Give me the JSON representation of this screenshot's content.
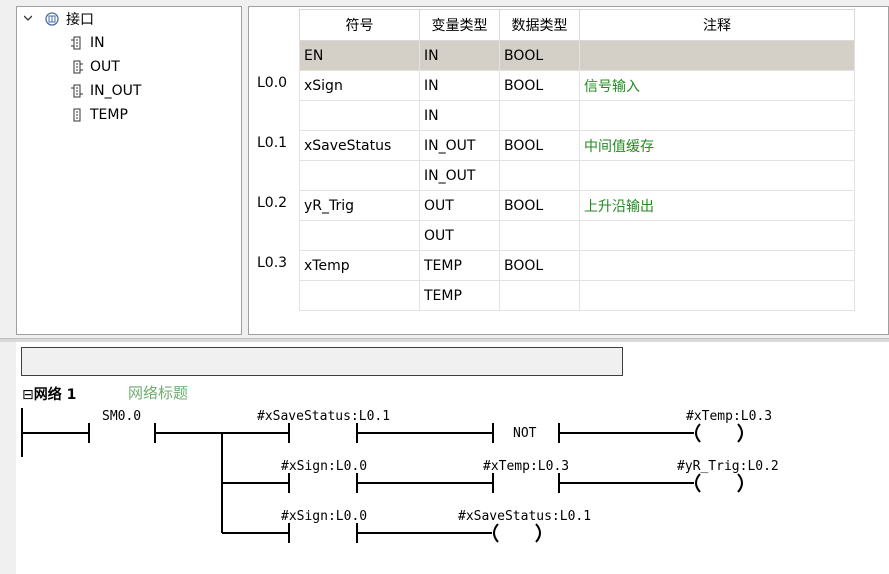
{
  "tree": {
    "root_label": "接口",
    "items": [
      {
        "label": "IN"
      },
      {
        "label": "OUT"
      },
      {
        "label": "IN_OUT"
      },
      {
        "label": "TEMP"
      }
    ]
  },
  "table": {
    "headers": [
      "符号",
      "变量类型",
      "数据类型",
      "注释"
    ],
    "rows": [
      {
        "addr": "",
        "symbol": "EN",
        "vartype": "IN",
        "datatype": "BOOL",
        "comment": ""
      },
      {
        "addr": "L0.0",
        "symbol": "xSign",
        "vartype": "IN",
        "datatype": "BOOL",
        "comment": "信号输入"
      },
      {
        "addr": "",
        "symbol": "",
        "vartype": "IN",
        "datatype": "",
        "comment": ""
      },
      {
        "addr": "L0.1",
        "symbol": "xSaveStatus",
        "vartype": "IN_OUT",
        "datatype": "BOOL",
        "comment": "中间值缓存"
      },
      {
        "addr": "",
        "symbol": "",
        "vartype": "IN_OUT",
        "datatype": "",
        "comment": ""
      },
      {
        "addr": "L0.2",
        "symbol": "yR_Trig",
        "vartype": "OUT",
        "datatype": "BOOL",
        "comment": "上升沿输出"
      },
      {
        "addr": "",
        "symbol": "",
        "vartype": "OUT",
        "datatype": "",
        "comment": ""
      },
      {
        "addr": "L0.3",
        "symbol": "xTemp",
        "vartype": "TEMP",
        "datatype": "BOOL",
        "comment": ""
      },
      {
        "addr": "",
        "symbol": "",
        "vartype": "TEMP",
        "datatype": "",
        "comment": ""
      }
    ]
  },
  "network": {
    "label": "网络 1",
    "title": "网络标题",
    "title_input_value": ""
  },
  "ladder": {
    "sm00": "SM0.0",
    "r1_contact": "#xSaveStatus:L0.1",
    "r1_not": "NOT",
    "r1_coil": "#xTemp:L0.3",
    "r2_contact1": "#xSign:L0.0",
    "r2_contact2": "#xTemp:L0.3",
    "r2_coil": "#yR_Trig:L0.2",
    "r3_contact": "#xSign:L0.0",
    "r3_coil": "#xSaveStatus:L0.1"
  }
}
